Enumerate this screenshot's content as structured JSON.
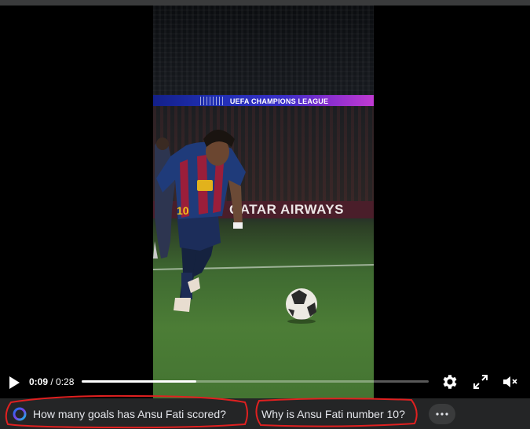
{
  "video": {
    "current_time": "0:09",
    "separator": " / ",
    "duration": "0:28",
    "progress_fraction": 0.33,
    "stadium": {
      "ucl_banner": "UEFA CHAMPIONS LEAGUE",
      "sponsor_board": "QATAR AIRWAYS",
      "shirt_number": "10"
    }
  },
  "controls": {
    "icons": [
      "play-icon",
      "settings-gear-icon",
      "fullscreen-icon",
      "volume-muted-icon"
    ]
  },
  "suggestions": {
    "items": [
      {
        "label": "How many goals has Ansu Fati scored?",
        "icon": "meta-ai-icon"
      },
      {
        "label": "Why is Ansu Fati number 10?"
      }
    ],
    "more_icon": "more-horizontal-icon"
  },
  "colors": {
    "suggest_bar_bg": "#242526",
    "annotation_red": "#e02020",
    "progress_fill": "#ffffff"
  }
}
